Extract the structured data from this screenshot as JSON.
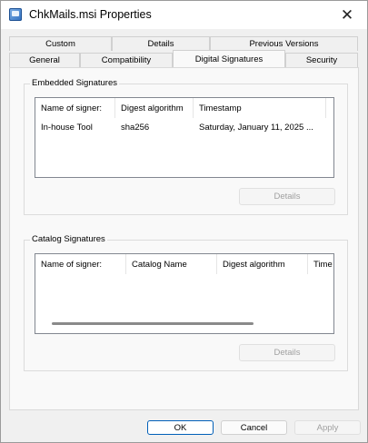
{
  "window": {
    "title": "ChkMails.msi Properties",
    "close_glyph": "✕"
  },
  "tabs": {
    "back_row": [
      "Custom",
      "Details",
      "Previous Versions"
    ],
    "front_row": [
      "General",
      "Compatibility",
      "Digital Signatures",
      "Security"
    ],
    "active": "Digital Signatures"
  },
  "embedded": {
    "group_label": "Embedded Signatures",
    "columns": [
      "Name of signer:",
      "Digest algorithm",
      "Timestamp"
    ],
    "rows": [
      [
        "In-house Tool",
        "sha256",
        "Saturday, January 11, 2025 ..."
      ]
    ],
    "details_button": "Details"
  },
  "catalog": {
    "group_label": "Catalog Signatures",
    "columns": [
      "Name of signer:",
      "Catalog Name",
      "Digest algorithm",
      "Time"
    ],
    "details_button": "Details"
  },
  "footer": {
    "ok": "OK",
    "cancel": "Cancel",
    "apply": "Apply"
  }
}
